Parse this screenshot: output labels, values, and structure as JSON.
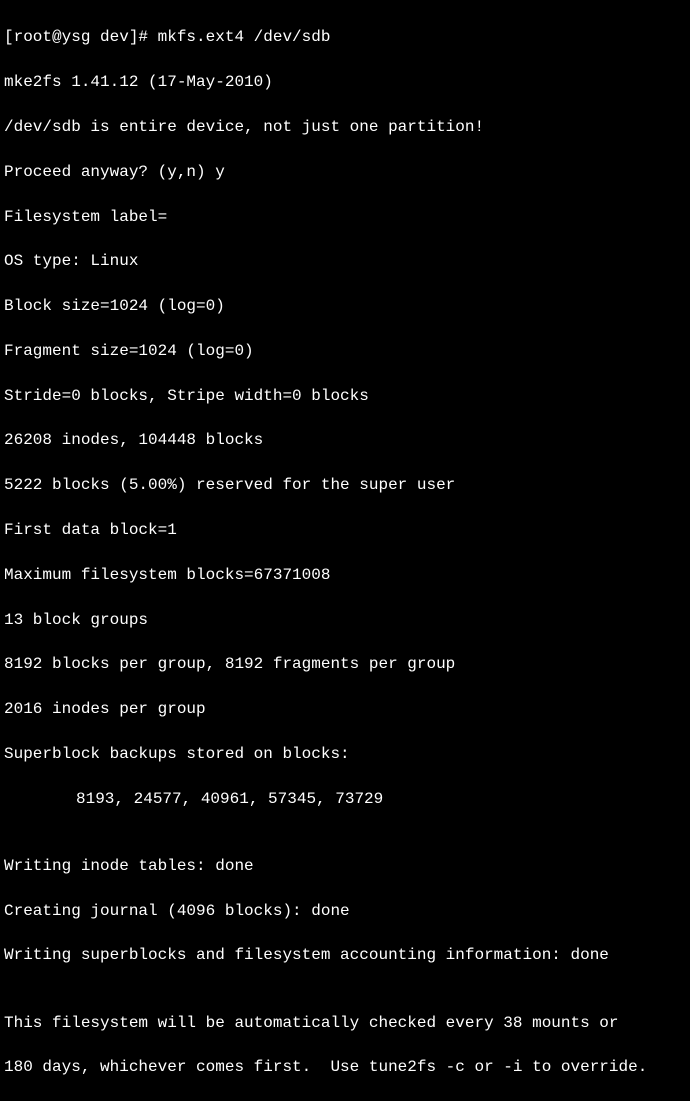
{
  "prompt": "[root@ysg dev]# ",
  "command": "mkfs.ext4 /dev/sdb",
  "lines": {
    "l1": "mke2fs 1.41.12 (17-May-2010)",
    "l2": "/dev/sdb is entire device, not just one partition!",
    "l3": "Proceed anyway? (y,n) y",
    "l4": "Filesystem label=",
    "l5": "OS type: Linux",
    "l6": "Block size=1024 (log=0)",
    "l7": "Fragment size=1024 (log=0)",
    "l8": "Stride=0 blocks, Stripe width=0 blocks",
    "l9": "26208 inodes, 104448 blocks",
    "l10": "5222 blocks (5.00%) reserved for the super user",
    "l11": "First data block=1",
    "l12": "Maximum filesystem blocks=67371008",
    "l13": "13 block groups",
    "l14": "8192 blocks per group, 8192 fragments per group",
    "l15": "2016 inodes per group",
    "l16": "Superblock backups stored on blocks:",
    "l17": "8193, 24577, 40961, 57345, 73729",
    "l18": "",
    "l19": "Writing inode tables: done",
    "l20": "Creating journal (4096 blocks): done",
    "l21": "Writing superblocks and filesystem accounting information: done",
    "l22": "",
    "l23": "This filesystem will be automatically checked every 38 mounts or",
    "l24": "180 days, whichever comes first.  Use tune2fs -c or -i to override."
  }
}
